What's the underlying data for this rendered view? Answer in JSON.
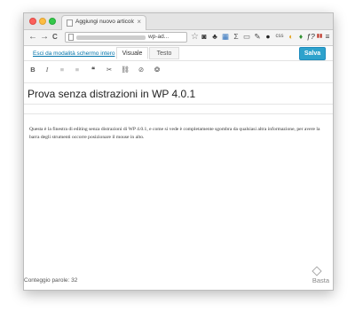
{
  "browser": {
    "tab_title": "Aggiungi nuovo articolo",
    "tab_close": "×",
    "url_suffix": "wp-ad...",
    "nav": {
      "back": "←",
      "forward": "→",
      "reload": "C"
    },
    "star": "☆",
    "extensions": [
      "◙",
      "♣",
      "▦",
      "Σ",
      "▭",
      "✎",
      "●",
      "css",
      "◐",
      "♦",
      "ƒ?",
      "▮▮",
      "≡"
    ]
  },
  "editor": {
    "exit_link": "Esci da modalità schermo intero",
    "mode_visual": "Visuale",
    "mode_text": "Testo",
    "save_label": "Salva",
    "toolbar_icons": [
      "B",
      "I",
      "≡",
      "≡",
      "❝",
      "✂",
      "⛓",
      "⊘",
      "❂"
    ],
    "post_title": "Prova senza distrazioni in WP 4.0.1",
    "content": "Questa è la finestra di editing senza distrazioni di WP 4.0.1, e come si vede è completamente sgombra da qualsiasi altra informazione, per avere la barra degli strumenti occorre posizionare il mouse in alto.",
    "word_count": "Conteggio parole: 32"
  },
  "watermark": {
    "text": "Basta"
  }
}
